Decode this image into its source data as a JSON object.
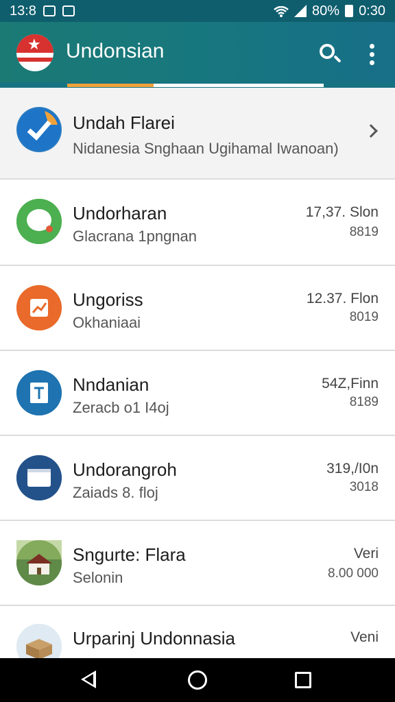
{
  "status_bar": {
    "time": "13:8",
    "battery": "80%",
    "clock": "0:30"
  },
  "app_bar": {
    "title": "Undonsian"
  },
  "items": [
    {
      "title": "Undah Flarei",
      "subtitle": "Nidanesia Snghaan Ugihamal Iwanoan)",
      "meta": "",
      "meta2": "",
      "icon": "check-badge-icon",
      "color": "#2a7cc2"
    },
    {
      "title": "Undorharan",
      "subtitle": "Glacrana 1pngnan",
      "meta": "17,37. Slon",
      "meta2": "8819",
      "icon": "chat-bubble-icon",
      "color": "#4caf50"
    },
    {
      "title": "Ungoriss",
      "subtitle": "Okhaniaai",
      "meta": "12.37. Flon",
      "meta2": "8019",
      "icon": "chart-icon",
      "color": "#e96a2a"
    },
    {
      "title": "Nndanian",
      "subtitle": "Zeracb o1 I4oj",
      "meta": "54Z,Finn",
      "meta2": "8189",
      "icon": "document-icon",
      "color": "#1e73b0"
    },
    {
      "title": "Undorangroh",
      "subtitle": "Zaiads 8. floj",
      "meta": "319,/I0n",
      "meta2": "3018",
      "icon": "folder-icon",
      "color": "#23528b"
    },
    {
      "title": "Sngurte: Flara",
      "subtitle": "Selonin",
      "meta": "Veri",
      "meta2": "8.00 000",
      "icon": "house-icon",
      "color": "#4c6b3a"
    },
    {
      "title": "Urparinj Undonnasia",
      "subtitle": "",
      "meta": "Veni",
      "meta2": "",
      "icon": "package-icon",
      "color": "#d9e8f2"
    }
  ]
}
